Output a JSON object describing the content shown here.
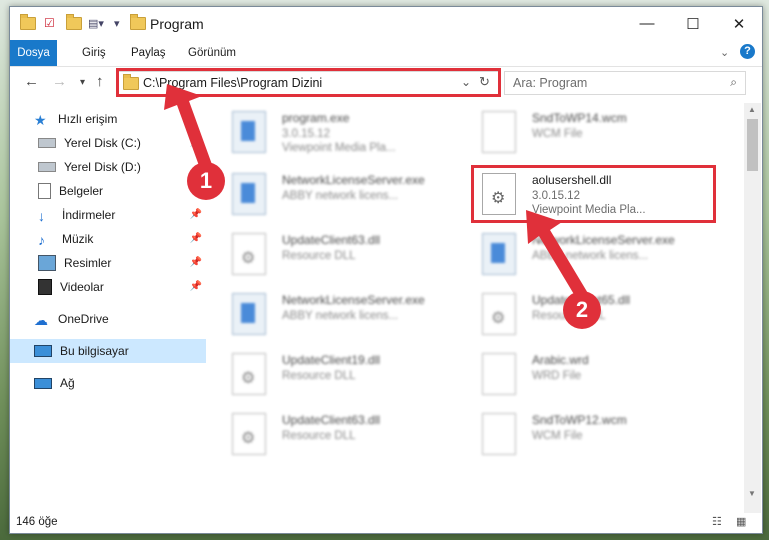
{
  "window": {
    "title": "Program"
  },
  "ribbon": {
    "tabs": [
      "Dosya",
      "Giriş",
      "Paylaş",
      "Görünüm"
    ]
  },
  "address": {
    "path": "C:\\Program Files\\Program Dizini",
    "search_placeholder": "Ara: Program"
  },
  "nav": {
    "items": [
      {
        "label": "Hızlı erişim",
        "icon": "star-icon"
      },
      {
        "label": "Yerel Disk (C:)",
        "icon": "drive-icon"
      },
      {
        "label": "Yerel Disk (D:)",
        "icon": "drive-icon"
      },
      {
        "label": "Belgeler",
        "icon": "documents-icon"
      },
      {
        "label": "İndirmeler",
        "icon": "download-icon"
      },
      {
        "label": "Müzik",
        "icon": "music-icon"
      },
      {
        "label": "Resimler",
        "icon": "pictures-icon"
      },
      {
        "label": "Videolar",
        "icon": "video-icon"
      },
      {
        "label": "OneDrive",
        "icon": "cloud-icon"
      },
      {
        "label": "Bu bilgisayar",
        "icon": "computer-icon"
      },
      {
        "label": "Ağ",
        "icon": "network-icon"
      }
    ]
  },
  "files": [
    {
      "name": "program.exe",
      "l2": "3.0.15.12",
      "l3": "Viewpoint Media Pla..."
    },
    {
      "name": "SndToWP14.wcm",
      "l2": "WCM File",
      "l3": ""
    },
    {
      "name": "NetworkLicenseServer.exe",
      "l2": "ABBY network licens...",
      "l3": ""
    },
    {
      "name": "aolusershell.dll",
      "l2": "3.0.15.12",
      "l3": "Viewpoint Media Pla..."
    },
    {
      "name": "UpdateClient63.dll",
      "l2": "Resource DLL",
      "l3": ""
    },
    {
      "name": "NetworkLicenseServer.exe",
      "l2": "ABBY network licens...",
      "l3": ""
    },
    {
      "name": "NetworkLicenseServer.exe",
      "l2": "ABBY network licens...",
      "l3": ""
    },
    {
      "name": "UpdateClient65.dll",
      "l2": "Resource DLL",
      "l3": ""
    },
    {
      "name": "UpdateClient19.dll",
      "l2": "Resource DLL",
      "l3": ""
    },
    {
      "name": "Arabic.wrd",
      "l2": "WRD File",
      "l3": ""
    },
    {
      "name": "UpdateClient63.dll",
      "l2": "Resource DLL",
      "l3": ""
    },
    {
      "name": "SndToWP12.wcm",
      "l2": "WCM File",
      "l3": ""
    }
  ],
  "status": {
    "count": "146 öğe"
  },
  "markers": [
    "1",
    "2"
  ],
  "colors": {
    "accent": "#1979ca",
    "highlight": "#e0303a",
    "selected_nav": "#cce8ff"
  }
}
